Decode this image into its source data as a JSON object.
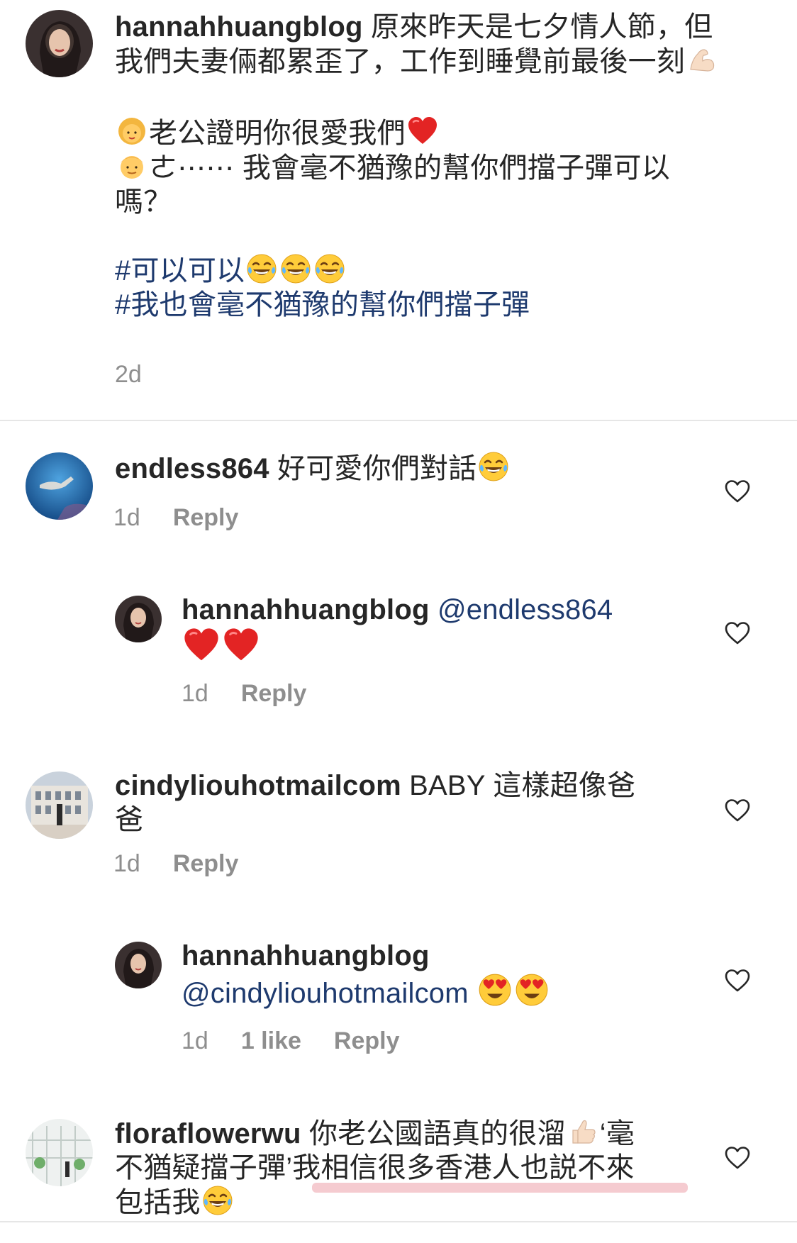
{
  "caption": {
    "username": "hannahhuangblog",
    "line1": " 原來昨天是七夕情人節，但",
    "line2": "我們夫妻倆都累歪了，工作到睡覺前最後一刻",
    "line3": "老公證明你很愛我們",
    "line4": "ㄜ⋯⋯ 我會毫不猶豫的幫你們擋子彈可以",
    "line5": "嗎？",
    "hashtag1": "#可以可以",
    "hashtag2": "#我也會毫不猶豫的幫你們擋子彈",
    "time": "2d"
  },
  "comments": [
    {
      "username": "endless864",
      "text": " 好可愛你們對話",
      "time": "1d",
      "reply_label": "Reply"
    },
    {
      "username": "hannahhuangblog",
      "mention": " @endless864",
      "time": "1d",
      "reply_label": "Reply"
    },
    {
      "username": "cindyliouhotmailcom",
      "text_line1": " BABY 這樣超像爸",
      "text_line2": "爸",
      "time": "1d",
      "reply_label": "Reply"
    },
    {
      "username": "hannahhuangblog",
      "mention": "@cindyliouhotmailcom",
      "time": "1d",
      "likes": "1 like",
      "reply_label": "Reply"
    },
    {
      "username": "floraflowerwu",
      "text_line1": " 你老公國語真的很溜",
      "text_line1b": "‘毫",
      "text_line2": "不猶疑擋子彈’我相信很多香港人也説不來",
      "text_line3": "包括我"
    }
  ],
  "icons": {
    "like": "heart-outline-icon",
    "emoji_laugh": "face-with-tears-of-joy-emoji",
    "emoji_heart": "red-heart-emoji",
    "emoji_heart_eyes": "heart-eyes-emoji",
    "emoji_muscle": "flexed-biceps-emoji",
    "emoji_thumbs": "thumbs-up-emoji",
    "emoji_woman": "woman-emoji",
    "emoji_man": "man-emoji"
  },
  "colors": {
    "text": "#262626",
    "meta": "#8e8e8e",
    "link": "#1e3a6e",
    "highlight": "#e88c96"
  }
}
